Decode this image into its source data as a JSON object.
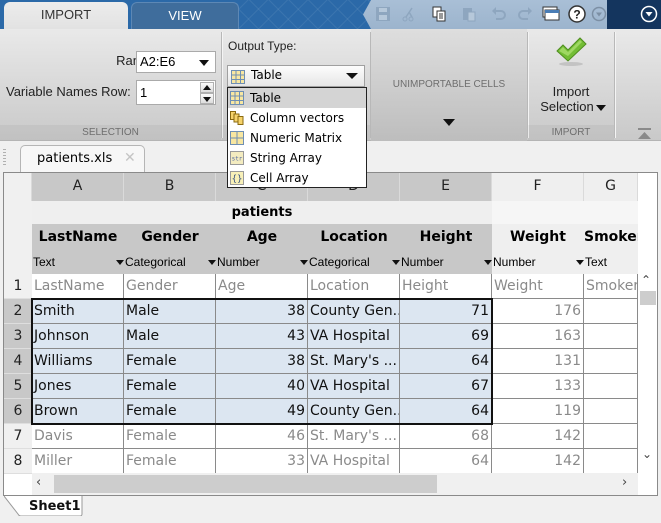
{
  "ribbon_tabs": [
    {
      "label": "IMPORT",
      "active": true
    },
    {
      "label": "VIEW",
      "active": false
    }
  ],
  "quick_access": [
    {
      "icon": "save-icon",
      "enabled": false
    },
    {
      "icon": "cut-icon",
      "enabled": false
    },
    {
      "icon": "copy-icon",
      "enabled": true
    },
    {
      "icon": "paste-icon",
      "enabled": false
    },
    {
      "icon": "undo-icon",
      "enabled": false
    },
    {
      "icon": "redo-icon",
      "enabled": false
    },
    {
      "icon": "window-layout-icon",
      "enabled": true
    },
    {
      "icon": "help-icon",
      "enabled": true
    },
    {
      "icon": "options-dropdown-icon",
      "enabled": false
    },
    {
      "icon": "expand-menu-icon",
      "enabled": true
    }
  ],
  "selection": {
    "range_label": "Range:",
    "range_value": "A2:E6",
    "varnames_label": "Variable Names Row:",
    "varnames_value": "1",
    "section_label": "SELECTION"
  },
  "output_type": {
    "label": "Output Type:",
    "selected": "Table",
    "options": [
      {
        "label": "Table",
        "icon": "table-icon",
        "highlighted": true
      },
      {
        "label": "Column vectors",
        "icon": "column-vectors-icon",
        "highlighted": false
      },
      {
        "label": "Numeric Matrix",
        "icon": "numeric-matrix-icon",
        "highlighted": false
      },
      {
        "label": "String Array",
        "icon": "string-array-icon",
        "highlighted": false
      },
      {
        "label": "Cell Array",
        "icon": "cell-array-icon",
        "highlighted": false
      }
    ]
  },
  "unimportable": {
    "label": "UNIMPORTABLE CELLS"
  },
  "import": {
    "button_line1": "Import",
    "button_line2": "Selection",
    "section_label": "IMPORT"
  },
  "document_tab": {
    "label": "patients.xls"
  },
  "grid": {
    "table_name": "patients",
    "columns": [
      {
        "letter": "A",
        "var_name": "LastName",
        "type": "Text",
        "in_output": true
      },
      {
        "letter": "B",
        "var_name": "Gender",
        "type": "Categorical",
        "in_output": true
      },
      {
        "letter": "C",
        "var_name": "Age",
        "type": "Number",
        "in_output": true
      },
      {
        "letter": "D",
        "var_name": "Location",
        "type": "Categorical",
        "in_output": true
      },
      {
        "letter": "E",
        "var_name": "Height",
        "type": "Number",
        "in_output": true
      },
      {
        "letter": "F",
        "var_name": "Weight",
        "type": "Number",
        "in_output": false
      },
      {
        "letter": "G",
        "var_name": "Smoker",
        "type": "Text",
        "in_output": false
      }
    ],
    "rows": [
      {
        "n": "1",
        "selected": false,
        "cells": [
          "LastName",
          "Gender",
          "Age",
          "Location",
          "Height",
          "Weight",
          "Smoker"
        ]
      },
      {
        "n": "2",
        "selected": true,
        "cells": [
          "Smith",
          "Male",
          "38",
          "County Gen...",
          "71",
          "176",
          ""
        ]
      },
      {
        "n": "3",
        "selected": true,
        "cells": [
          "Johnson",
          "Male",
          "43",
          "VA Hospital",
          "69",
          "163",
          ""
        ]
      },
      {
        "n": "4",
        "selected": true,
        "cells": [
          "Williams",
          "Female",
          "38",
          "St. Mary's ...",
          "64",
          "131",
          ""
        ]
      },
      {
        "n": "5",
        "selected": true,
        "cells": [
          "Jones",
          "Female",
          "40",
          "VA Hospital",
          "67",
          "133",
          ""
        ]
      },
      {
        "n": "6",
        "selected": true,
        "cells": [
          "Brown",
          "Female",
          "49",
          "County Gen...",
          "64",
          "119",
          ""
        ]
      },
      {
        "n": "7",
        "selected": false,
        "cells": [
          "Davis",
          "Female",
          "46",
          "St. Mary's ...",
          "68",
          "142",
          ""
        ]
      },
      {
        "n": "8",
        "selected": false,
        "cells": [
          "Miller",
          "Female",
          "33",
          "VA Hospital",
          "64",
          "142",
          ""
        ]
      }
    ],
    "numeric_columns": [
      2,
      4,
      5
    ]
  },
  "sheet_tab": {
    "label": "Sheet1"
  },
  "colors": {
    "title_blue": "#2b69a8",
    "selection_fill": "#dce6f1",
    "header_gray": "#c8c8c8",
    "accent_green": "#6ab52d"
  }
}
